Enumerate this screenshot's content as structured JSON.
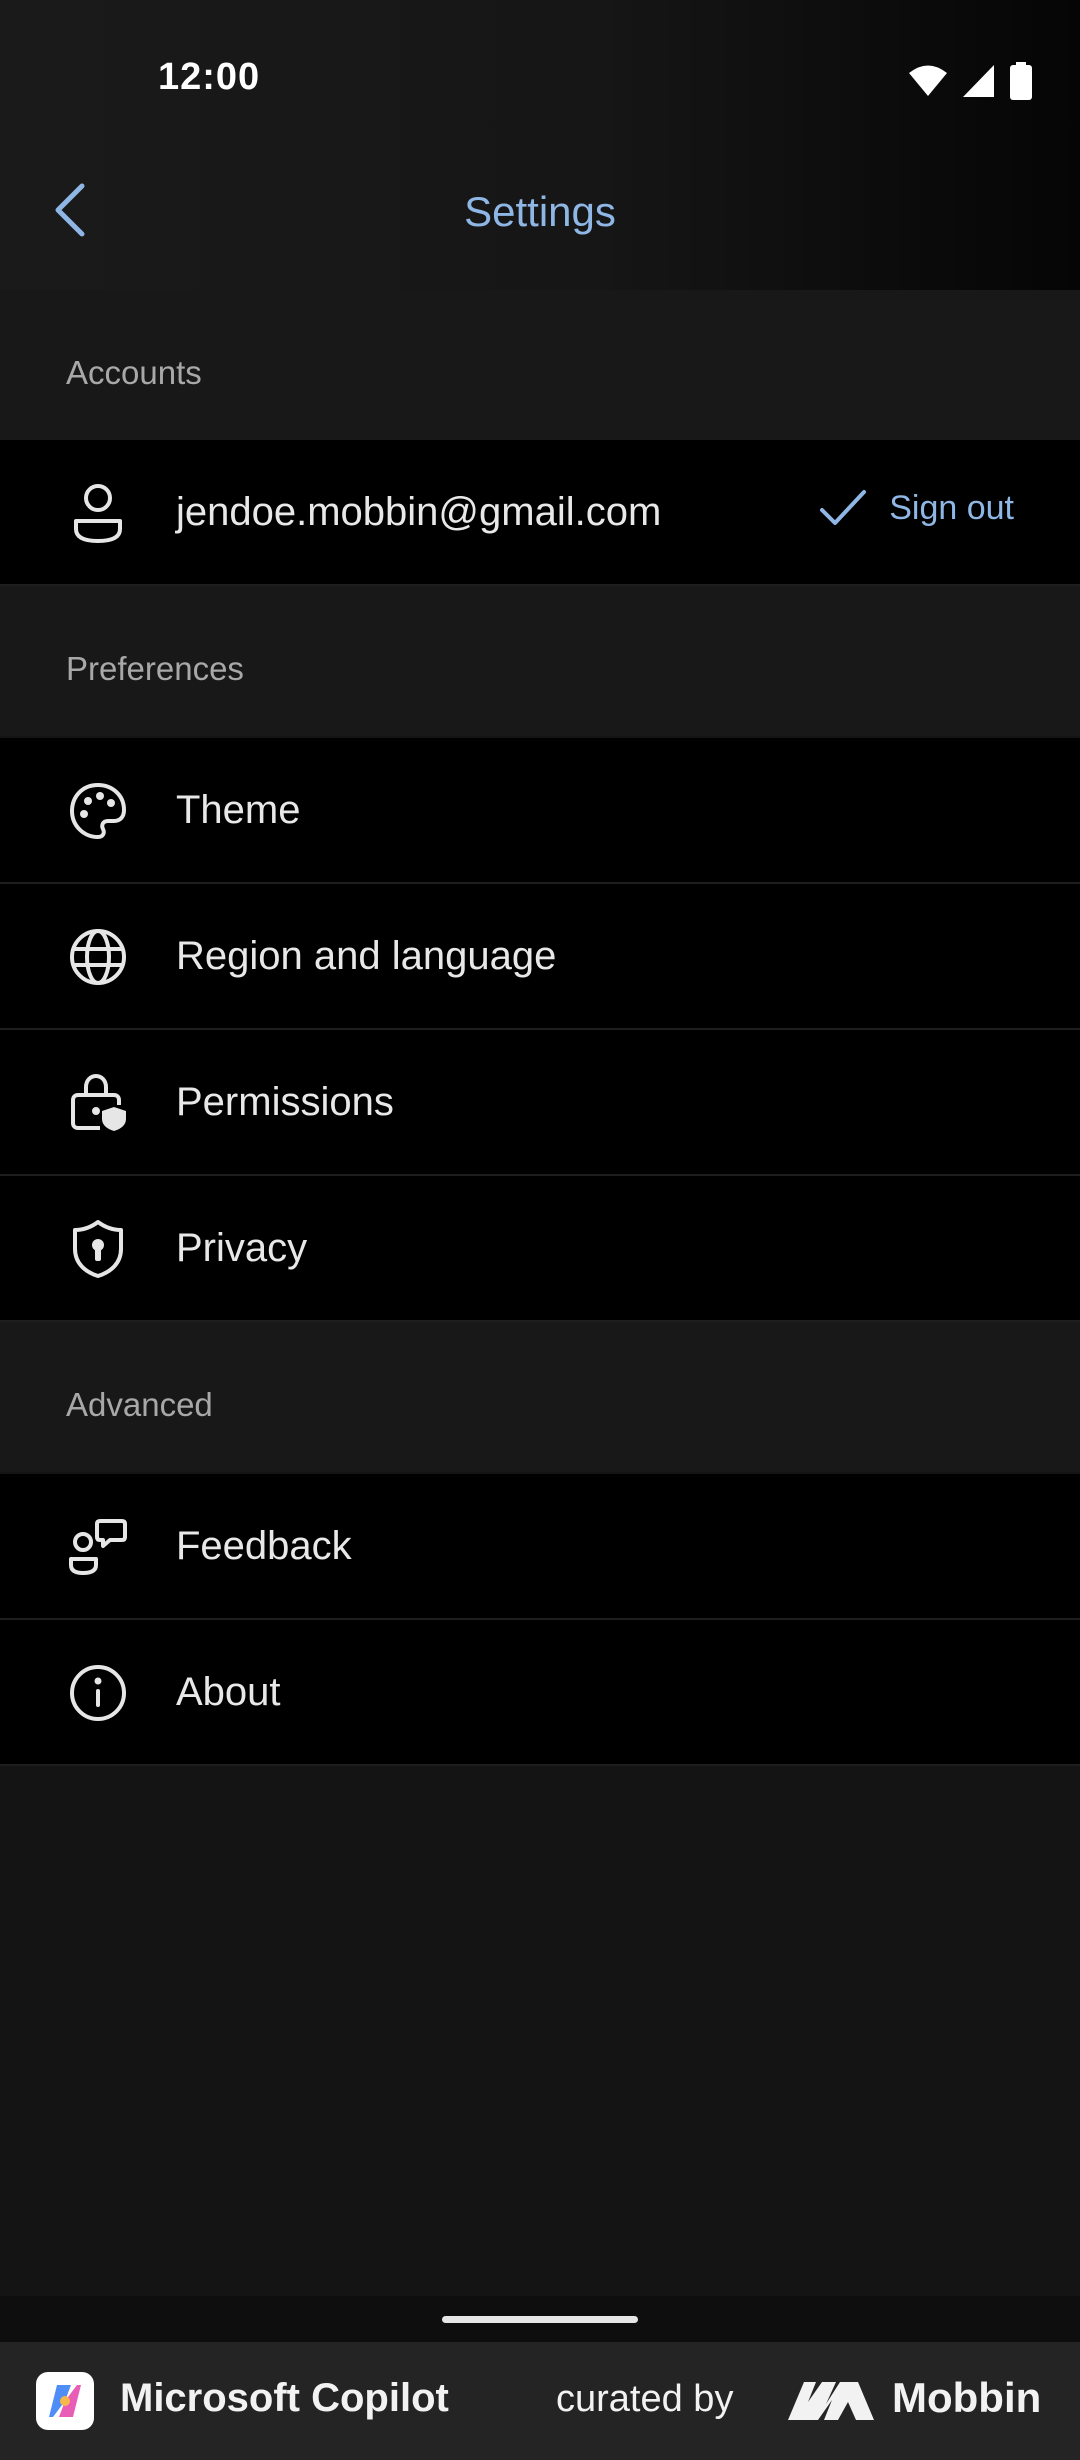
{
  "status": {
    "time": "12:00"
  },
  "header": {
    "title": "Settings"
  },
  "sections": {
    "accounts": {
      "title": "Accounts",
      "email": "jendoe.mobbin@gmail.com",
      "sign_out": "Sign out"
    },
    "preferences": {
      "title": "Preferences",
      "items": [
        {
          "label": "Theme",
          "icon": "palette-icon"
        },
        {
          "label": "Region and language",
          "icon": "globe-icon"
        },
        {
          "label": "Permissions",
          "icon": "lock-shield-icon"
        },
        {
          "label": "Privacy",
          "icon": "shield-keyhole-icon"
        }
      ]
    },
    "advanced": {
      "title": "Advanced",
      "items": [
        {
          "label": "Feedback",
          "icon": "person-feedback-icon"
        },
        {
          "label": "About",
          "icon": "info-icon"
        }
      ]
    }
  },
  "footer": {
    "app_name": "Microsoft Copilot",
    "curated_by": "curated by",
    "brand": "Mobbin"
  },
  "colors": {
    "accent": "#8fb7e6",
    "background": "#141414",
    "row_background": "#000000"
  }
}
